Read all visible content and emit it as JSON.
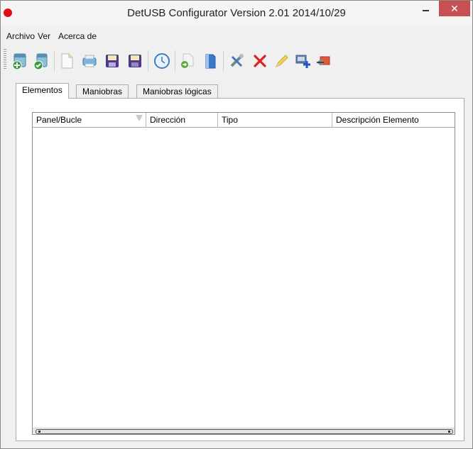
{
  "window": {
    "title": "DetUSB Configurator Version 2.01 2014/10/29",
    "close_glyph": "✕"
  },
  "menu": {
    "items": [
      "Archivo",
      "Ver",
      "Acerca de"
    ]
  },
  "toolbar": {
    "buttons": [
      "connect-device-icon",
      "disconnect-device-icon",
      "new-file-icon",
      "print-icon",
      "save-icon",
      "save-as-icon",
      "clock-icon",
      "send-icon",
      "read-icon",
      "tools-icon",
      "delete-icon",
      "edit-icon",
      "add-element-icon",
      "remove-element-icon"
    ]
  },
  "tabs": [
    "Elementos",
    "Maniobras",
    "Maniobras lógicas"
  ],
  "table": {
    "columns": [
      "Panel/Bucle",
      "Dirección",
      "Tipo",
      "Descripción Elemento"
    ],
    "rows": []
  }
}
